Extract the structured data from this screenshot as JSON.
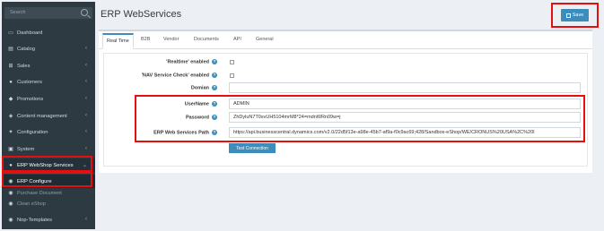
{
  "sidebar": {
    "search_placeholder": "Search",
    "items": [
      {
        "label": "Dashboard",
        "icon": "desktop-icon"
      },
      {
        "label": "Catalog",
        "icon": "book-icon"
      },
      {
        "label": "Sales",
        "icon": "cart-icon"
      },
      {
        "label": "Customers",
        "icon": "user-icon"
      },
      {
        "label": "Promotions",
        "icon": "tag-icon"
      },
      {
        "label": "Content management",
        "icon": "cubes-icon"
      },
      {
        "label": "Configuration",
        "icon": "gears-icon"
      },
      {
        "label": "System",
        "icon": "cube-icon"
      },
      {
        "label": "ERP WebShop Services",
        "icon": "circle-icon"
      },
      {
        "label": "ERP Configure",
        "icon": "circle-dot-icon"
      },
      {
        "label": "Purchase Document",
        "icon": "circle-dot-icon"
      },
      {
        "label": "Clean eShop",
        "icon": "circle-dot-icon"
      },
      {
        "label": "Nop-Templates",
        "icon": "circle-dot-icon"
      }
    ]
  },
  "header": {
    "title": "ERP WebServices",
    "save_label": "Save"
  },
  "tabs": [
    "Real Time",
    "B2B",
    "Vendor",
    "Documents",
    "API",
    "General"
  ],
  "form": {
    "realtime_label": "'Realtime' enabled",
    "nav_check_label": "'NAV Service Check' enabled",
    "domain_label": "Domian",
    "domain_value": "",
    "username_label": "UserName",
    "username_value": "ADMIN",
    "password_label": "Password",
    "password_value": "ZhDyluN7T0svUH5104mrM8*24=mdnWRn09w=j",
    "path_label": "ERP Web Services Path",
    "path_value": "https://api.businesscentral.dynamics.com/v2.0/22d5f13e-a98e-45b7-af9a-f0c9ac69;428/Sandbox-eShop/WE/CRONUS%20USA%2C%20I",
    "test_button": "Test Connection"
  },
  "colors": {
    "accent": "#3c8dbc",
    "sidebar_bg": "#2d3a42",
    "highlight_box": "#e60f0f"
  }
}
